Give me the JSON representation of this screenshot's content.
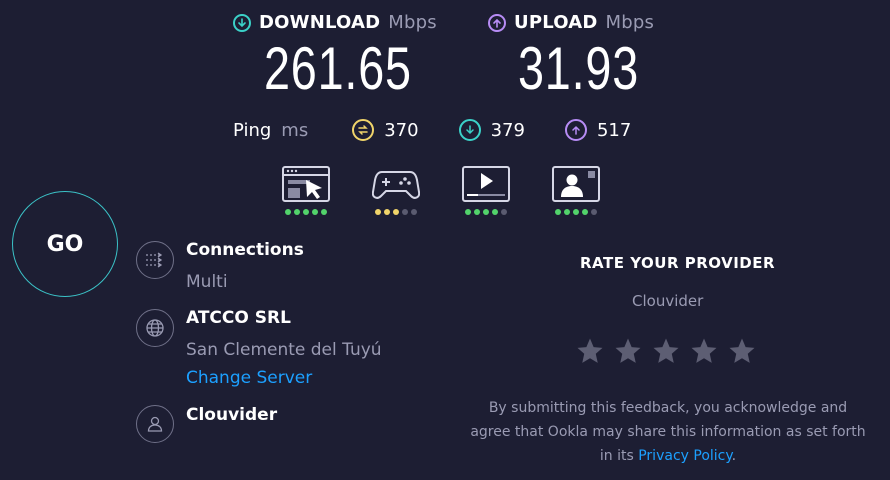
{
  "download": {
    "label": "DOWNLOAD",
    "unit": "Mbps",
    "value": "261.65",
    "icon": "arrow-down-circle-icon",
    "color": "#3bd1c8"
  },
  "upload": {
    "label": "UPLOAD",
    "unit": "Mbps",
    "value": "31.93",
    "icon": "arrow-up-circle-icon",
    "color": "#b78cf5"
  },
  "ping": {
    "label": "Ping",
    "unit": "ms",
    "idle": {
      "value": "370",
      "icon": "idle-ping-icon",
      "color": "#f0d46a"
    },
    "download": {
      "value": "379",
      "icon": "download-ping-icon",
      "color": "#3bd1c8"
    },
    "upload": {
      "value": "517",
      "icon": "upload-ping-icon",
      "color": "#b78cf5"
    }
  },
  "quality": [
    {
      "name": "web-browsing",
      "icon": "browser-cursor-icon",
      "rating": 5,
      "color": "#52d36b"
    },
    {
      "name": "gaming",
      "icon": "gamepad-icon",
      "rating": 3,
      "color": "#f0d46a"
    },
    {
      "name": "video-streaming",
      "icon": "video-play-icon",
      "rating": 4,
      "color": "#52d36b"
    },
    {
      "name": "video-chat",
      "icon": "video-chat-icon",
      "rating": 4,
      "color": "#52d36b"
    }
  ],
  "go": {
    "label": "GO"
  },
  "connections": {
    "title": "Connections",
    "value": "Multi",
    "icon": "connections-icon"
  },
  "server": {
    "title": "ATCCO SRL",
    "location": "San Clemente del Tuyú",
    "change_label": "Change Server",
    "icon": "globe-icon"
  },
  "provider": {
    "title": "Clouvider",
    "icon": "user-icon"
  },
  "rate": {
    "title": "RATE YOUR PROVIDER",
    "provider": "Clouvider",
    "stars": 5,
    "disclaimer_before": "By submitting this feedback, you acknowledge and agree that Ookla may share this information as set forth in its ",
    "privacy_link": "Privacy Policy",
    "disclaimer_after": "."
  }
}
